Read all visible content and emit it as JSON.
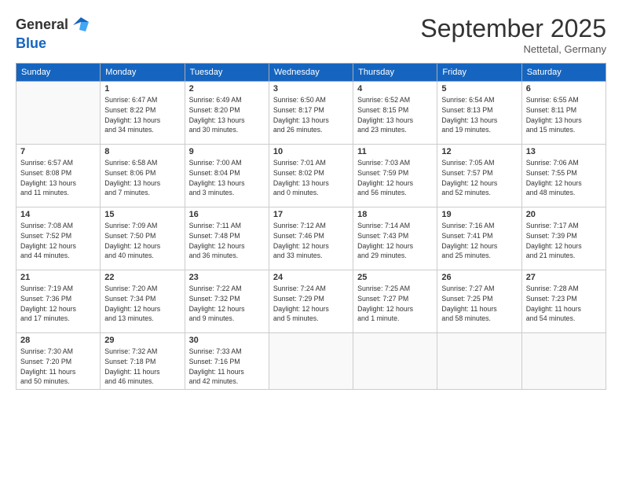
{
  "header": {
    "logo_general": "General",
    "logo_blue": "Blue",
    "month_title": "September 2025",
    "location": "Nettetal, Germany"
  },
  "calendar": {
    "days_of_week": [
      "Sunday",
      "Monday",
      "Tuesday",
      "Wednesday",
      "Thursday",
      "Friday",
      "Saturday"
    ],
    "weeks": [
      [
        {
          "day": "",
          "info": ""
        },
        {
          "day": "1",
          "info": "Sunrise: 6:47 AM\nSunset: 8:22 PM\nDaylight: 13 hours\nand 34 minutes."
        },
        {
          "day": "2",
          "info": "Sunrise: 6:49 AM\nSunset: 8:20 PM\nDaylight: 13 hours\nand 30 minutes."
        },
        {
          "day": "3",
          "info": "Sunrise: 6:50 AM\nSunset: 8:17 PM\nDaylight: 13 hours\nand 26 minutes."
        },
        {
          "day": "4",
          "info": "Sunrise: 6:52 AM\nSunset: 8:15 PM\nDaylight: 13 hours\nand 23 minutes."
        },
        {
          "day": "5",
          "info": "Sunrise: 6:54 AM\nSunset: 8:13 PM\nDaylight: 13 hours\nand 19 minutes."
        },
        {
          "day": "6",
          "info": "Sunrise: 6:55 AM\nSunset: 8:11 PM\nDaylight: 13 hours\nand 15 minutes."
        }
      ],
      [
        {
          "day": "7",
          "info": "Sunrise: 6:57 AM\nSunset: 8:08 PM\nDaylight: 13 hours\nand 11 minutes."
        },
        {
          "day": "8",
          "info": "Sunrise: 6:58 AM\nSunset: 8:06 PM\nDaylight: 13 hours\nand 7 minutes."
        },
        {
          "day": "9",
          "info": "Sunrise: 7:00 AM\nSunset: 8:04 PM\nDaylight: 13 hours\nand 3 minutes."
        },
        {
          "day": "10",
          "info": "Sunrise: 7:01 AM\nSunset: 8:02 PM\nDaylight: 13 hours\nand 0 minutes."
        },
        {
          "day": "11",
          "info": "Sunrise: 7:03 AM\nSunset: 7:59 PM\nDaylight: 12 hours\nand 56 minutes."
        },
        {
          "day": "12",
          "info": "Sunrise: 7:05 AM\nSunset: 7:57 PM\nDaylight: 12 hours\nand 52 minutes."
        },
        {
          "day": "13",
          "info": "Sunrise: 7:06 AM\nSunset: 7:55 PM\nDaylight: 12 hours\nand 48 minutes."
        }
      ],
      [
        {
          "day": "14",
          "info": "Sunrise: 7:08 AM\nSunset: 7:52 PM\nDaylight: 12 hours\nand 44 minutes."
        },
        {
          "day": "15",
          "info": "Sunrise: 7:09 AM\nSunset: 7:50 PM\nDaylight: 12 hours\nand 40 minutes."
        },
        {
          "day": "16",
          "info": "Sunrise: 7:11 AM\nSunset: 7:48 PM\nDaylight: 12 hours\nand 36 minutes."
        },
        {
          "day": "17",
          "info": "Sunrise: 7:12 AM\nSunset: 7:46 PM\nDaylight: 12 hours\nand 33 minutes."
        },
        {
          "day": "18",
          "info": "Sunrise: 7:14 AM\nSunset: 7:43 PM\nDaylight: 12 hours\nand 29 minutes."
        },
        {
          "day": "19",
          "info": "Sunrise: 7:16 AM\nSunset: 7:41 PM\nDaylight: 12 hours\nand 25 minutes."
        },
        {
          "day": "20",
          "info": "Sunrise: 7:17 AM\nSunset: 7:39 PM\nDaylight: 12 hours\nand 21 minutes."
        }
      ],
      [
        {
          "day": "21",
          "info": "Sunrise: 7:19 AM\nSunset: 7:36 PM\nDaylight: 12 hours\nand 17 minutes."
        },
        {
          "day": "22",
          "info": "Sunrise: 7:20 AM\nSunset: 7:34 PM\nDaylight: 12 hours\nand 13 minutes."
        },
        {
          "day": "23",
          "info": "Sunrise: 7:22 AM\nSunset: 7:32 PM\nDaylight: 12 hours\nand 9 minutes."
        },
        {
          "day": "24",
          "info": "Sunrise: 7:24 AM\nSunset: 7:29 PM\nDaylight: 12 hours\nand 5 minutes."
        },
        {
          "day": "25",
          "info": "Sunrise: 7:25 AM\nSunset: 7:27 PM\nDaylight: 12 hours\nand 1 minute."
        },
        {
          "day": "26",
          "info": "Sunrise: 7:27 AM\nSunset: 7:25 PM\nDaylight: 11 hours\nand 58 minutes."
        },
        {
          "day": "27",
          "info": "Sunrise: 7:28 AM\nSunset: 7:23 PM\nDaylight: 11 hours\nand 54 minutes."
        }
      ],
      [
        {
          "day": "28",
          "info": "Sunrise: 7:30 AM\nSunset: 7:20 PM\nDaylight: 11 hours\nand 50 minutes."
        },
        {
          "day": "29",
          "info": "Sunrise: 7:32 AM\nSunset: 7:18 PM\nDaylight: 11 hours\nand 46 minutes."
        },
        {
          "day": "30",
          "info": "Sunrise: 7:33 AM\nSunset: 7:16 PM\nDaylight: 11 hours\nand 42 minutes."
        },
        {
          "day": "",
          "info": ""
        },
        {
          "day": "",
          "info": ""
        },
        {
          "day": "",
          "info": ""
        },
        {
          "day": "",
          "info": ""
        }
      ]
    ]
  }
}
